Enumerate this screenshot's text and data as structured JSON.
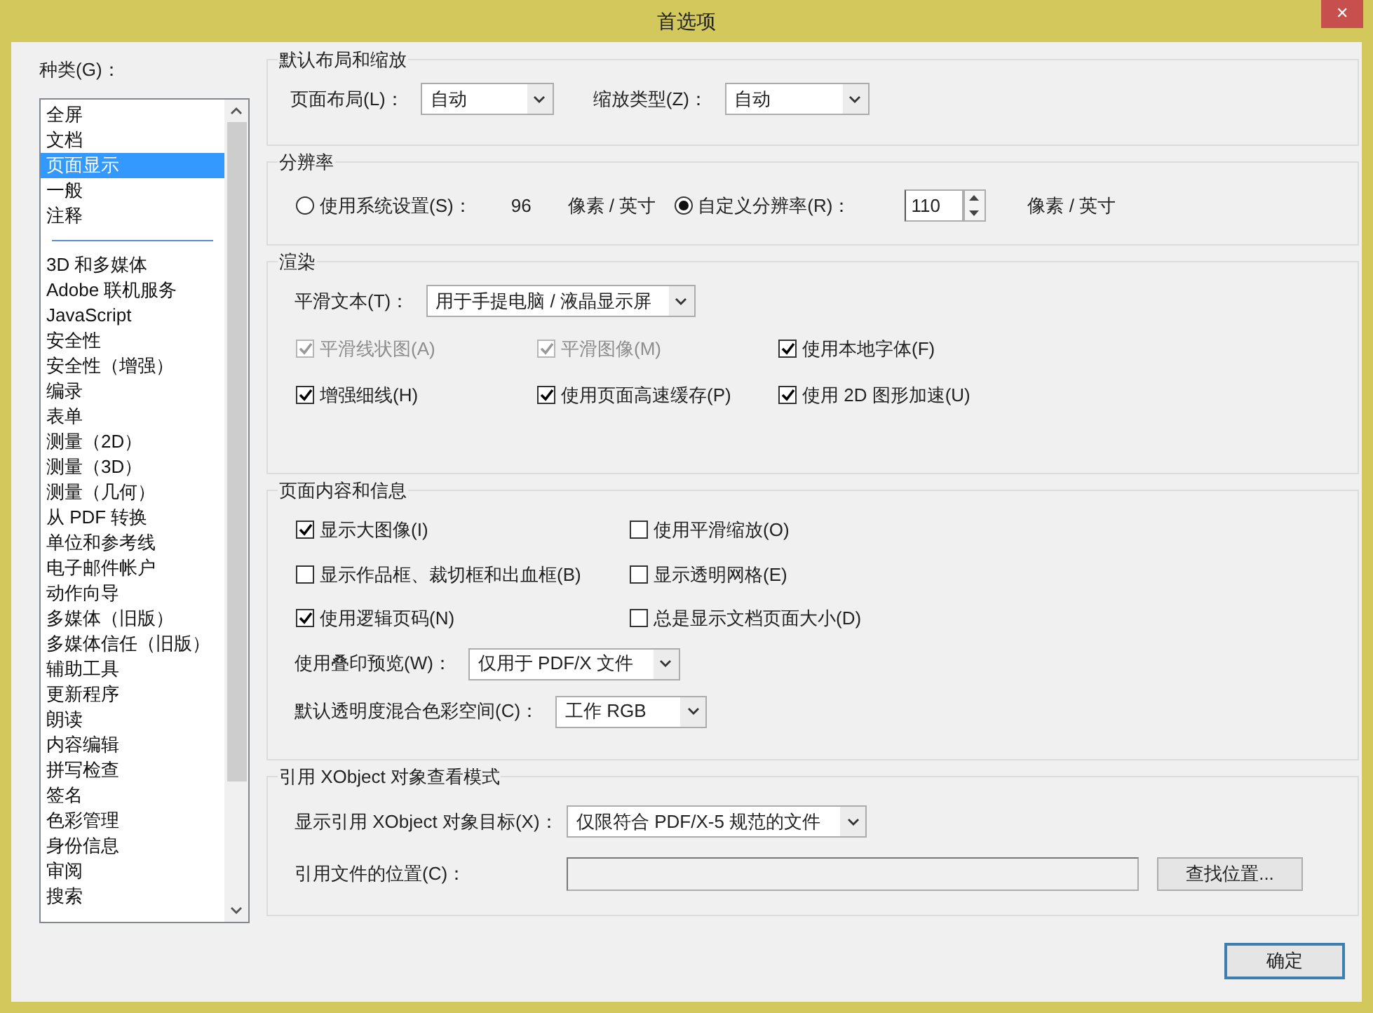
{
  "window": {
    "title": "首选项",
    "close": "✕"
  },
  "categories": {
    "label": "种类(G)：",
    "groups": [
      {
        "items": [
          {
            "label": "全屏",
            "selected": false
          },
          {
            "label": "文档",
            "selected": false
          },
          {
            "label": "页面显示",
            "selected": true
          },
          {
            "label": "一般",
            "selected": false
          },
          {
            "label": "注释",
            "selected": false
          }
        ]
      },
      {
        "items": [
          {
            "label": "3D 和多媒体",
            "selected": false
          },
          {
            "label": "Adobe 联机服务",
            "selected": false
          },
          {
            "label": "JavaScript",
            "selected": false
          },
          {
            "label": "安全性",
            "selected": false
          },
          {
            "label": "安全性（增强）",
            "selected": false
          },
          {
            "label": "编录",
            "selected": false
          },
          {
            "label": "表单",
            "selected": false
          },
          {
            "label": "测量（2D）",
            "selected": false
          },
          {
            "label": "测量（3D）",
            "selected": false
          },
          {
            "label": "测量（几何）",
            "selected": false
          },
          {
            "label": "从 PDF 转换",
            "selected": false
          },
          {
            "label": "单位和参考线",
            "selected": false
          },
          {
            "label": "电子邮件帐户",
            "selected": false
          },
          {
            "label": "动作向导",
            "selected": false
          },
          {
            "label": "多媒体（旧版）",
            "selected": false
          },
          {
            "label": "多媒体信任（旧版）",
            "selected": false
          },
          {
            "label": "辅助工具",
            "selected": false
          },
          {
            "label": "更新程序",
            "selected": false
          },
          {
            "label": "朗读",
            "selected": false
          },
          {
            "label": "内容编辑",
            "selected": false
          },
          {
            "label": "拼写检查",
            "selected": false
          },
          {
            "label": "签名",
            "selected": false
          },
          {
            "label": "色彩管理",
            "selected": false
          },
          {
            "label": "身份信息",
            "selected": false
          },
          {
            "label": "审阅",
            "selected": false
          },
          {
            "label": "搜索",
            "selected": false
          }
        ]
      }
    ]
  },
  "layout": {
    "title": "默认布局和缩放",
    "fields": [
      {
        "label": "页面布局(L)：",
        "value": "自动"
      },
      {
        "label": "缩放类型(Z)：",
        "value": "自动"
      }
    ]
  },
  "resolution": {
    "title": "分辨率",
    "options": [
      {
        "kind": "fixed",
        "label": "使用系统设置(S)：",
        "value": "96",
        "unit": "像素 / 英寸",
        "selected": false
      },
      {
        "kind": "spinner",
        "label": "自定义分辨率(R)：",
        "value": "110",
        "unit": "像素 / 英寸",
        "selected": true
      }
    ]
  },
  "rendering": {
    "title": "渲染",
    "smooth_text": {
      "label": "平滑文本(T)：",
      "value": "用于手提电脑 / 液晶显示屏"
    },
    "checkboxes": [
      {
        "label": "平滑线状图(A)",
        "checked": true,
        "disabled": true
      },
      {
        "label": "平滑图像(M)",
        "checked": true,
        "disabled": true
      },
      {
        "label": "使用本地字体(F)",
        "checked": true,
        "disabled": false
      },
      {
        "label": "增强细线(H)",
        "checked": true,
        "disabled": false
      },
      {
        "label": "使用页面高速缓存(P)",
        "checked": true,
        "disabled": false
      },
      {
        "label": "使用 2D 图形加速(U)",
        "checked": true,
        "disabled": false
      }
    ]
  },
  "page_content": {
    "title": "页面内容和信息",
    "checkboxes": [
      {
        "label": "显示大图像(I)",
        "checked": true
      },
      {
        "label": "使用平滑缩放(O)",
        "checked": false
      },
      {
        "label": "显示作品框、裁切框和出血框(B)",
        "checked": false
      },
      {
        "label": "显示透明网格(E)",
        "checked": false
      },
      {
        "label": "使用逻辑页码(N)",
        "checked": true
      },
      {
        "label": "总是显示文档页面大小(D)",
        "checked": false
      }
    ],
    "dropdowns": [
      {
        "label": "使用叠印预览(W)：",
        "value": "仅用于 PDF/X 文件"
      },
      {
        "label": "默认透明度混合色彩空间(C)：",
        "value": "工作 RGB"
      }
    ]
  },
  "xobject": {
    "title": "引用 XObject 对象查看模式",
    "target": {
      "label": "显示引用 XObject 对象目标(X)：",
      "value": "仅限符合 PDF/X-5 规范的文件"
    },
    "location": {
      "label": "引用文件的位置(C)：",
      "button": "查找位置..."
    }
  },
  "buttons": [
    "确定"
  ]
}
